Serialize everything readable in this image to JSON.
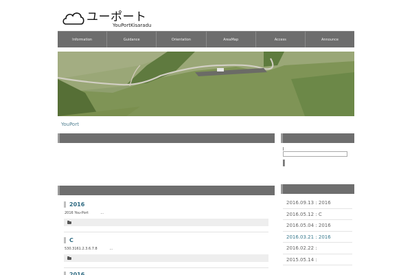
{
  "site": {
    "title": "ユーポート",
    "subtitle": "YouPortKisaradu"
  },
  "nav": [
    {
      "label": "Information"
    },
    {
      "label": "Guidance"
    },
    {
      "label": "Orientation"
    },
    {
      "label": "AreaMap"
    },
    {
      "label": "Access"
    },
    {
      "label": "Announce"
    }
  ],
  "breadcrumb": "YouPort",
  "posts": [
    {
      "title": "2016",
      "excerpt": "2016 You-Port",
      "more": "…"
    },
    {
      "title": "C",
      "excerpt": "530.3161.2.3.6.7.8",
      "more": "…"
    },
    {
      "title": "2016"
    }
  ],
  "sidebar": {
    "recent": [
      {
        "label": "2016.09.13 : 2016"
      },
      {
        "label": "2016.05.12 : C"
      },
      {
        "label": "2016.05.04 : 2016"
      },
      {
        "label": "2016.03.21 : 2016"
      },
      {
        "label": "2016.02.22 :"
      },
      {
        "label": "2015.05.14 :"
      }
    ]
  },
  "colors": {
    "nav_bg": "#6d6d6d",
    "section_bar": "#6e6e6e",
    "link": "#2e6a82",
    "meta_bg": "#eeeeee"
  },
  "icons": [
    "cloud-logo-icon",
    "folder-icon"
  ]
}
